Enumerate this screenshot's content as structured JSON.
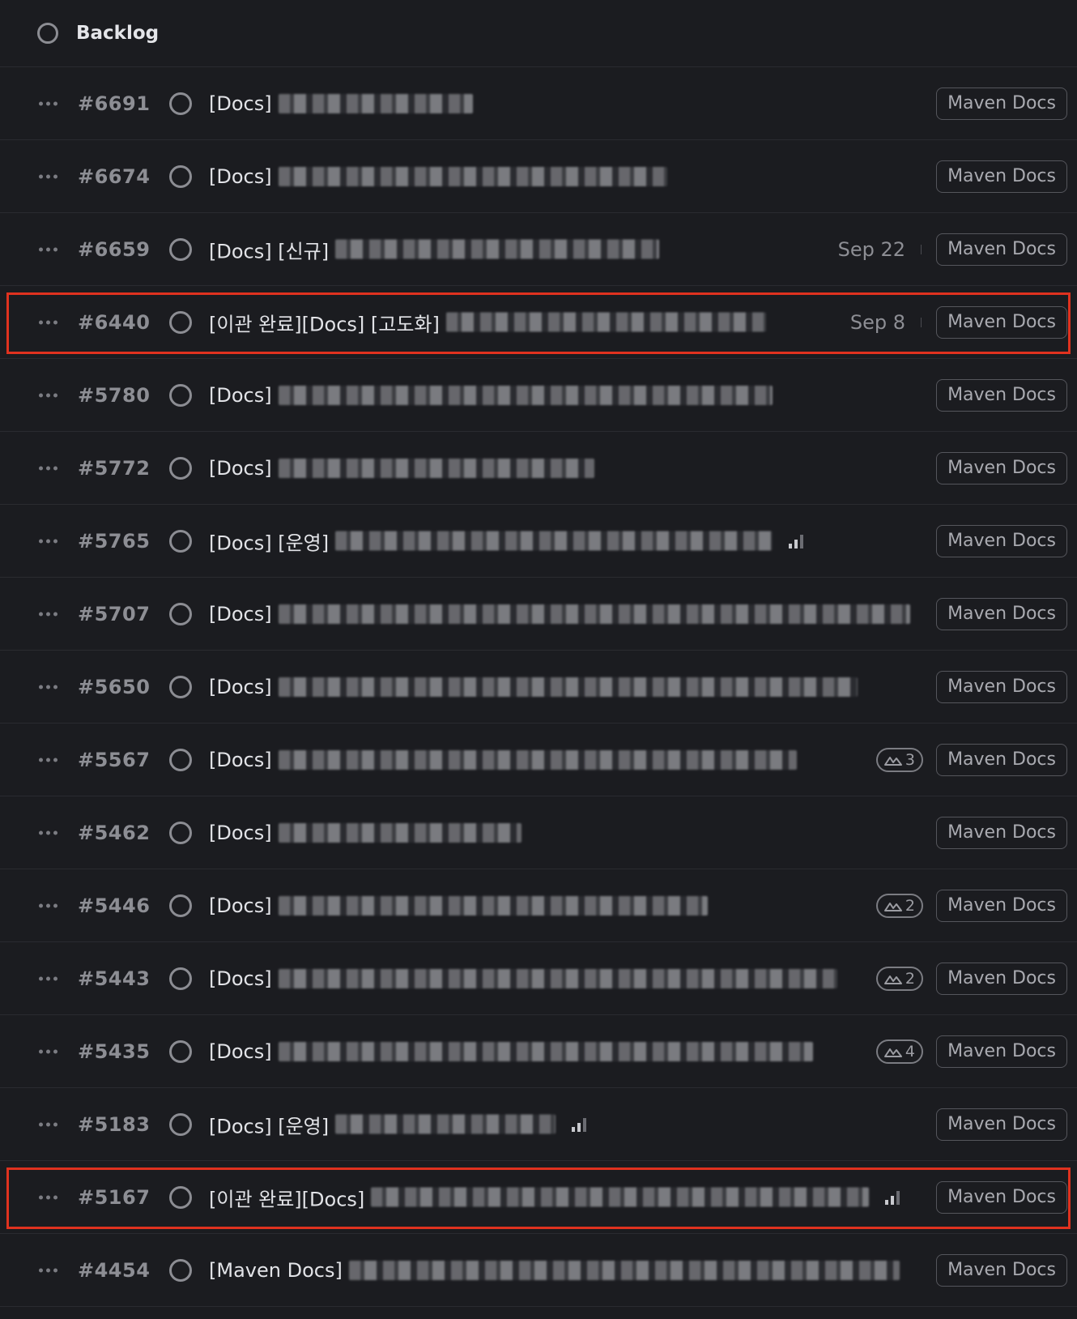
{
  "header": {
    "title": "Backlog"
  },
  "tag_label": "Maven Docs",
  "issues": [
    {
      "id": "#6691",
      "prefix": "[Docs]",
      "blur": 240
    },
    {
      "id": "#6674",
      "prefix": "[Docs]",
      "blur": 480
    },
    {
      "id": "#6659",
      "prefix": "[Docs] [신규]",
      "blur": 400,
      "date": "Sep 22"
    },
    {
      "id": "#6440",
      "prefix": "[이관 완료][Docs] [고도화]",
      "blur": 395,
      "date": "Sep 8",
      "highlighted": true
    },
    {
      "id": "#5780",
      "prefix": "[Docs]",
      "blur": 610
    },
    {
      "id": "#5772",
      "prefix": "[Docs]",
      "blur": 390
    },
    {
      "id": "#5765",
      "prefix": "[Docs] [운영]",
      "blur": 540,
      "priority": true
    },
    {
      "id": "#5707",
      "prefix": "[Docs]",
      "blur": 780
    },
    {
      "id": "#5650",
      "prefix": "[Docs]",
      "blur": 715
    },
    {
      "id": "#5567",
      "prefix": "[Docs]",
      "blur": 640,
      "sub_count": "3"
    },
    {
      "id": "#5462",
      "prefix": "[Docs]",
      "blur": 300
    },
    {
      "id": "#5446",
      "prefix": "[Docs]",
      "blur": 530,
      "sub_count": "2"
    },
    {
      "id": "#5443",
      "prefix": "[Docs]",
      "blur": 690,
      "sub_count": "2"
    },
    {
      "id": "#5435",
      "prefix": "[Docs]",
      "blur": 660,
      "sub_count": "4"
    },
    {
      "id": "#5183",
      "prefix": "[Docs] [운영]",
      "blur": 272,
      "priority": true
    },
    {
      "id": "#5167",
      "prefix": "[이관 완료][Docs]",
      "blur": 615,
      "priority": true,
      "highlighted": true
    },
    {
      "id": "#4454",
      "prefix": "[Maven Docs]",
      "blur": 680
    }
  ],
  "colors": {
    "background": "#1b1c20",
    "highlight": "#e0321f",
    "divider": "#2a2b30"
  },
  "icons": {
    "status": "circle-outline-icon",
    "more": "more-dots-icon",
    "priority": "priority-bars-icon",
    "sub_issue": "sub-issue-icon"
  }
}
